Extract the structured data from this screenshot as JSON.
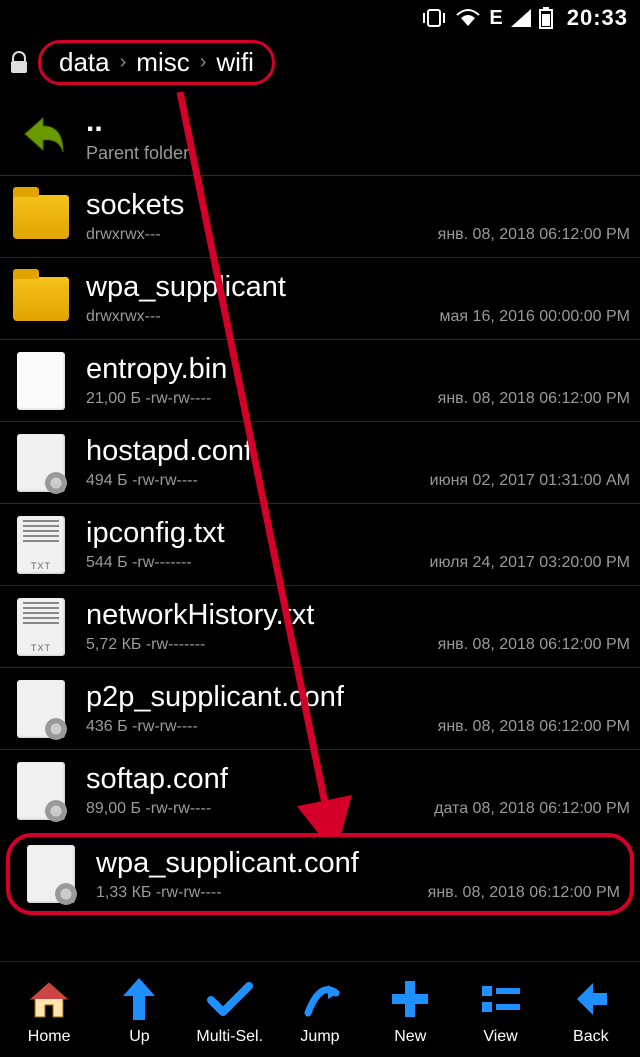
{
  "status": {
    "time": "20:33",
    "network": "E"
  },
  "breadcrumb": [
    "data",
    "misc",
    "wifi"
  ],
  "parent": {
    "dots": "..",
    "label": "Parent folder"
  },
  "files": [
    {
      "name": "sockets",
      "type": "folder",
      "detail": "drwxrwx---",
      "date": "янв. 08, 2018 06:12:00 PM"
    },
    {
      "name": "wpa_supplicant",
      "type": "folder",
      "detail": "drwxrwx---",
      "date": "мая 16, 2016 00:00:00 PM"
    },
    {
      "name": "entropy.bin",
      "type": "bin",
      "detail": "21,00 Б -rw-rw----",
      "date": "янв. 08, 2018 06:12:00 PM"
    },
    {
      "name": "hostapd.conf",
      "type": "conf",
      "detail": "494 Б -rw-rw----",
      "date": "июня 02, 2017 01:31:00 AM"
    },
    {
      "name": "ipconfig.txt",
      "type": "txt",
      "detail": "544 Б -rw-------",
      "date": "июля 24, 2017 03:20:00 PM"
    },
    {
      "name": "networkHistory.txt",
      "type": "txt",
      "detail": "5,72 КБ -rw-------",
      "date": "янв. 08, 2018 06:12:00 PM"
    },
    {
      "name": "p2p_supplicant.conf",
      "type": "conf",
      "detail": "436 Б -rw-rw----",
      "date": "янв. 08, 2018 06:12:00 PM"
    },
    {
      "name": "softap.conf",
      "type": "conf",
      "detail": "89,00 Б -rw-rw----",
      "date": "дата 08, 2018 06:12:00 PM"
    },
    {
      "name": "wpa_supplicant.conf",
      "type": "conf",
      "detail": "1,33 КБ -rw-rw----",
      "date": "янв. 08, 2018 06:12:00 PM",
      "highlight": true
    }
  ],
  "toolbar": [
    {
      "id": "home",
      "label": "Home"
    },
    {
      "id": "up",
      "label": "Up"
    },
    {
      "id": "multisel",
      "label": "Multi-Sel."
    },
    {
      "id": "jump",
      "label": "Jump"
    },
    {
      "id": "new",
      "label": "New"
    },
    {
      "id": "view",
      "label": "View"
    },
    {
      "id": "back",
      "label": "Back"
    }
  ]
}
